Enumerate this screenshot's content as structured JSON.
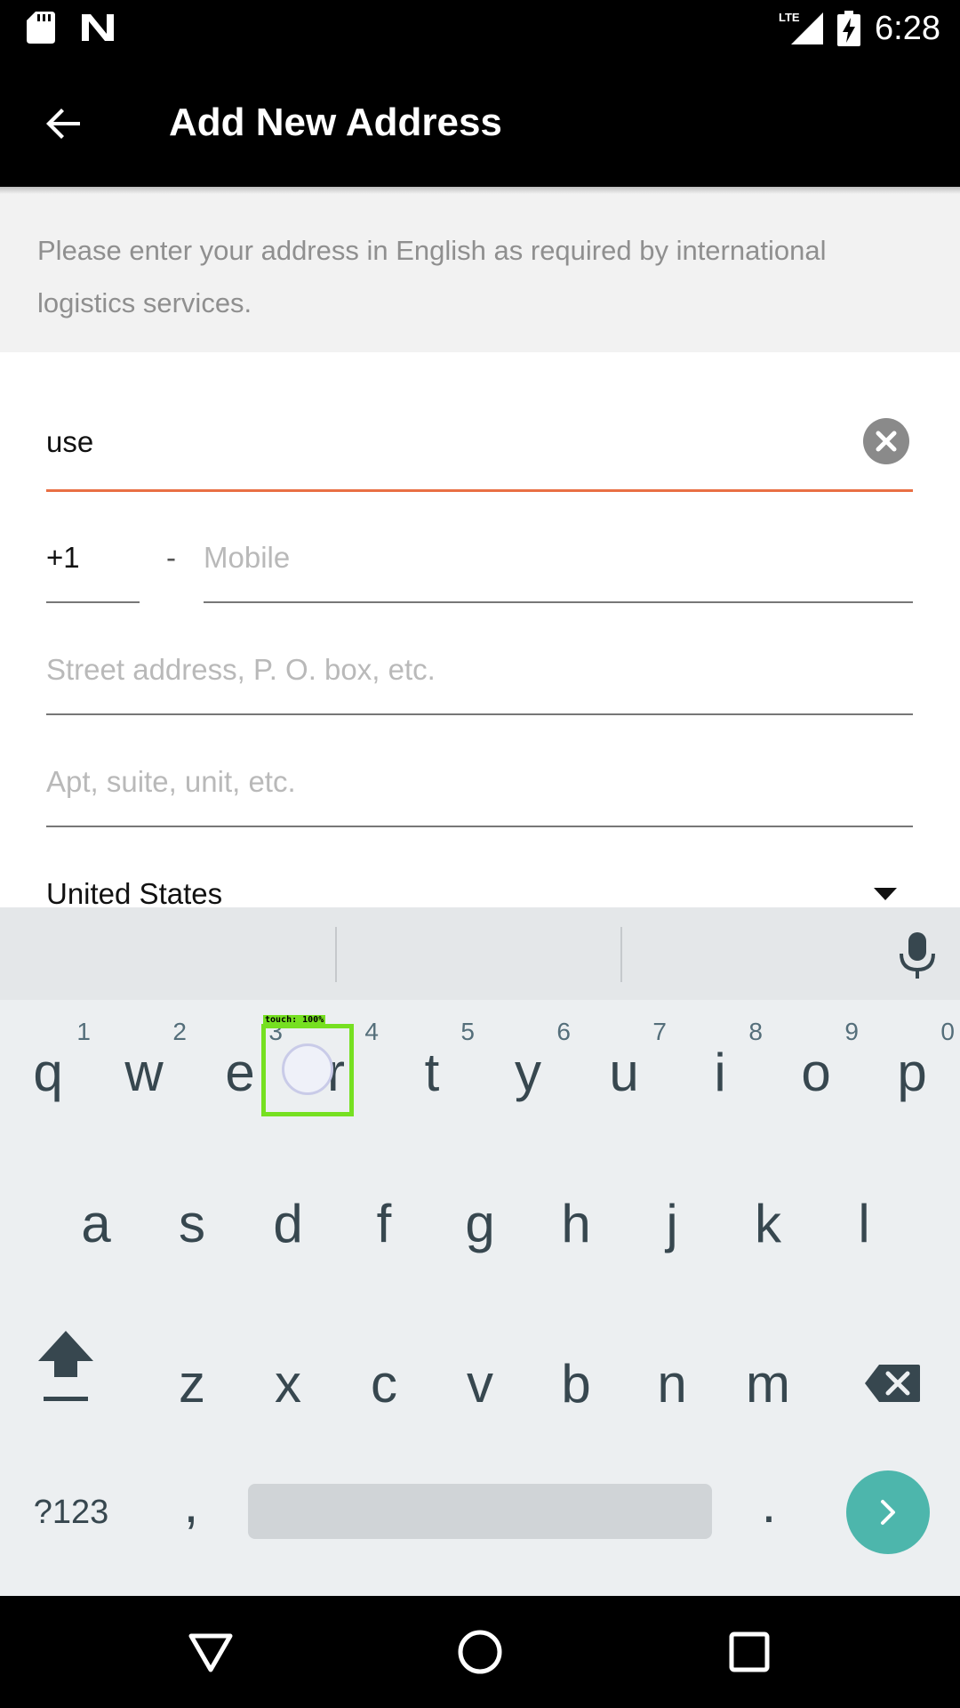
{
  "status_bar": {
    "time": "6:28",
    "network": "LTE",
    "icons": [
      "sd-card-icon",
      "n-icon",
      "lte-signal-icon",
      "battery-charging-icon"
    ]
  },
  "app_bar": {
    "title": "Add New Address",
    "back_icon": "arrow-back-icon"
  },
  "notice": {
    "text": "Please enter your address in English as required by international logistics services."
  },
  "form": {
    "name_value": "use",
    "phone_code": "+1",
    "phone_separator": "-",
    "mobile_placeholder": "Mobile",
    "street_placeholder": "Street address, P. O. box, etc.",
    "apt_placeholder": "Apt, suite, unit, etc.",
    "country_value": "United States"
  },
  "keyboard": {
    "row1": [
      {
        "key": "q",
        "hint": "1"
      },
      {
        "key": "w",
        "hint": "2"
      },
      {
        "key": "e",
        "hint": "3"
      },
      {
        "key": "r",
        "hint": "4"
      },
      {
        "key": "t",
        "hint": "5"
      },
      {
        "key": "y",
        "hint": "6"
      },
      {
        "key": "u",
        "hint": "7"
      },
      {
        "key": "i",
        "hint": "8"
      },
      {
        "key": "o",
        "hint": "9"
      },
      {
        "key": "p",
        "hint": "0"
      }
    ],
    "row2": [
      "a",
      "s",
      "d",
      "f",
      "g",
      "h",
      "j",
      "k",
      "l"
    ],
    "row3": [
      "z",
      "x",
      "c",
      "v",
      "b",
      "n",
      "m"
    ],
    "symbols_label": "?123",
    "comma_label": ",",
    "period_label": "."
  },
  "touch_overlay": {
    "label": "touch: 100%"
  },
  "colors": {
    "accent_underline": "#e96f44",
    "enter_key": "#4db6ac",
    "touch_box": "#76e021"
  }
}
